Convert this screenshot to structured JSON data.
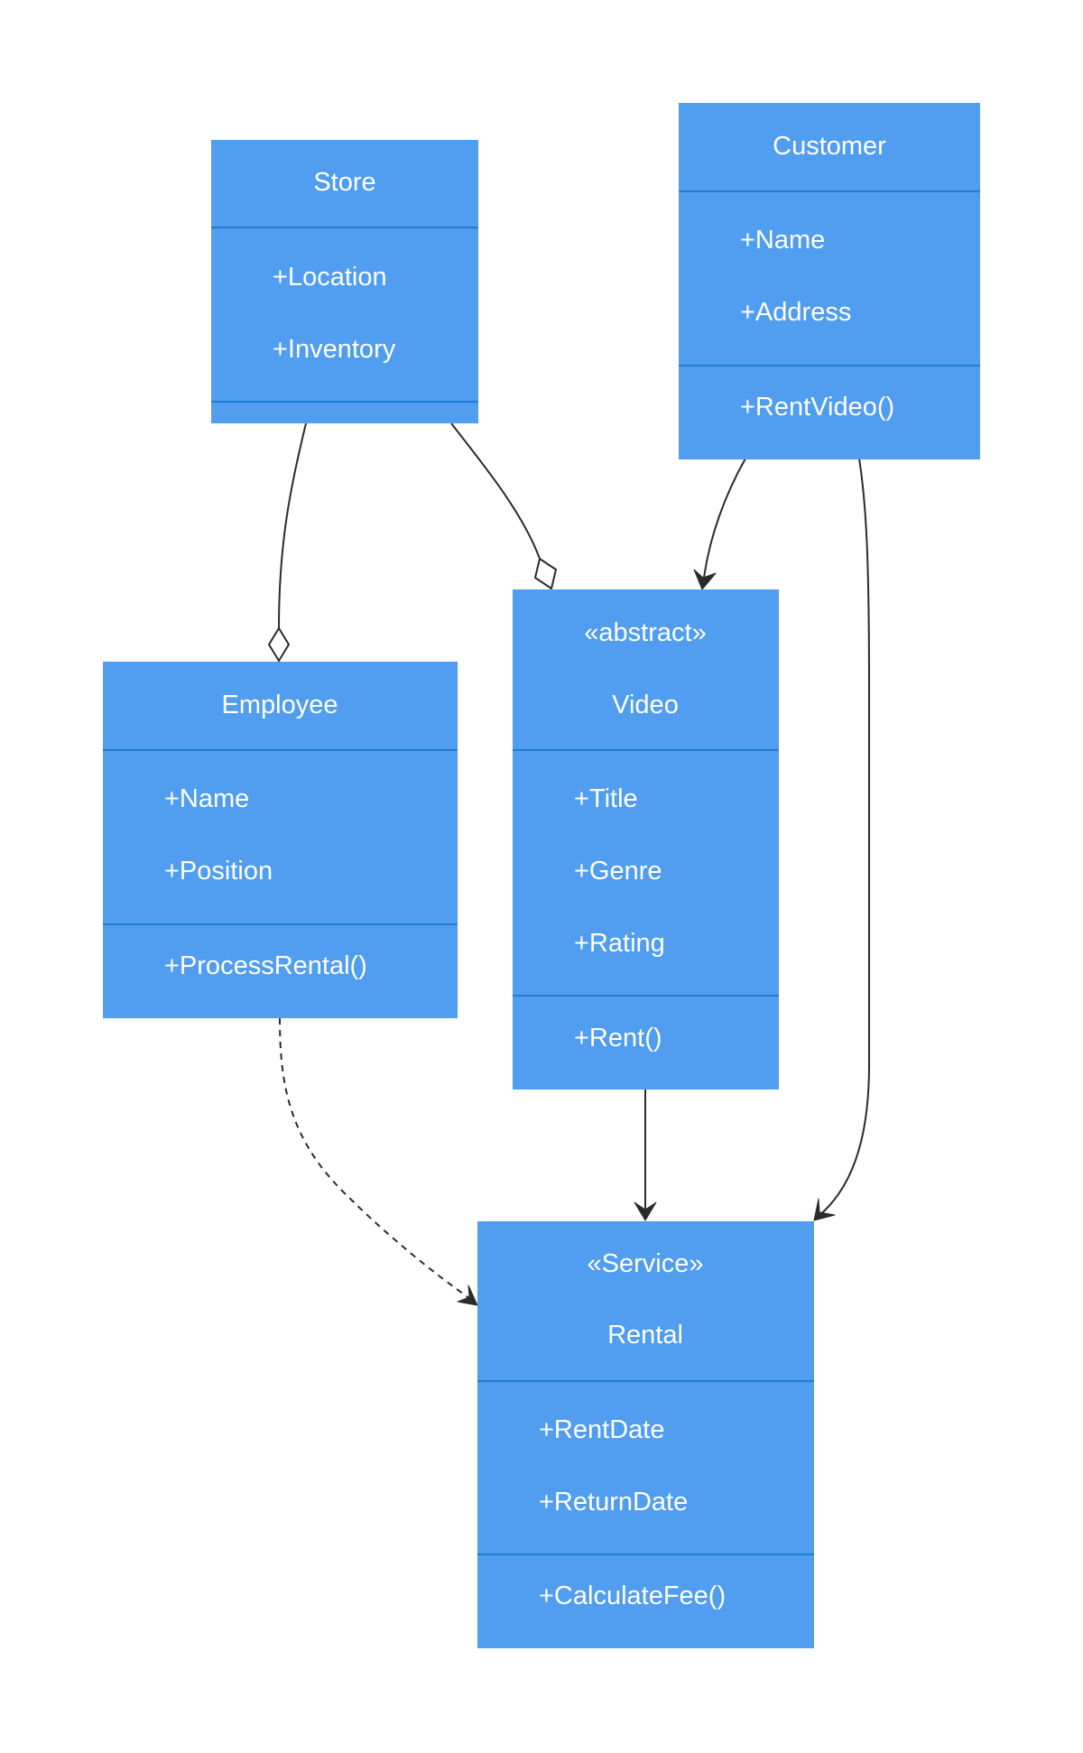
{
  "diagram": {
    "type": "uml-class-diagram",
    "classes": {
      "store": {
        "name": "Store",
        "stereotype": null,
        "attributes": [
          "+Location",
          "+Inventory"
        ],
        "methods": []
      },
      "customer": {
        "name": "Customer",
        "stereotype": null,
        "attributes": [
          "+Name",
          "+Address"
        ],
        "methods": [
          "+RentVideo()"
        ]
      },
      "employee": {
        "name": "Employee",
        "stereotype": null,
        "attributes": [
          "+Name",
          "+Position"
        ],
        "methods": [
          "+ProcessRental()"
        ]
      },
      "video": {
        "name": "Video",
        "stereotype": "«abstract»",
        "attributes": [
          "+Title",
          "+Genre",
          "+Rating"
        ],
        "methods": [
          "+Rent()"
        ]
      },
      "rental": {
        "name": "Rental",
        "stereotype": "«Service»",
        "attributes": [
          "+RentDate",
          "+ReturnDate"
        ],
        "methods": [
          "+CalculateFee()"
        ]
      }
    },
    "relationships": [
      {
        "from": "Store",
        "to": "Employee",
        "kind": "aggregation"
      },
      {
        "from": "Store",
        "to": "Video",
        "kind": "aggregation"
      },
      {
        "from": "Customer",
        "to": "Video",
        "kind": "association"
      },
      {
        "from": "Customer",
        "to": "Rental",
        "kind": "association"
      },
      {
        "from": "Video",
        "to": "Rental",
        "kind": "association"
      },
      {
        "from": "Employee",
        "to": "Rental",
        "kind": "dependency"
      }
    ],
    "colors": {
      "class_fill": "#519DEF",
      "compartment_divider": "#1E7DD5",
      "text": "#FFFFFF",
      "edge": "#2B2B2B",
      "background": "#FFFFFF"
    }
  }
}
